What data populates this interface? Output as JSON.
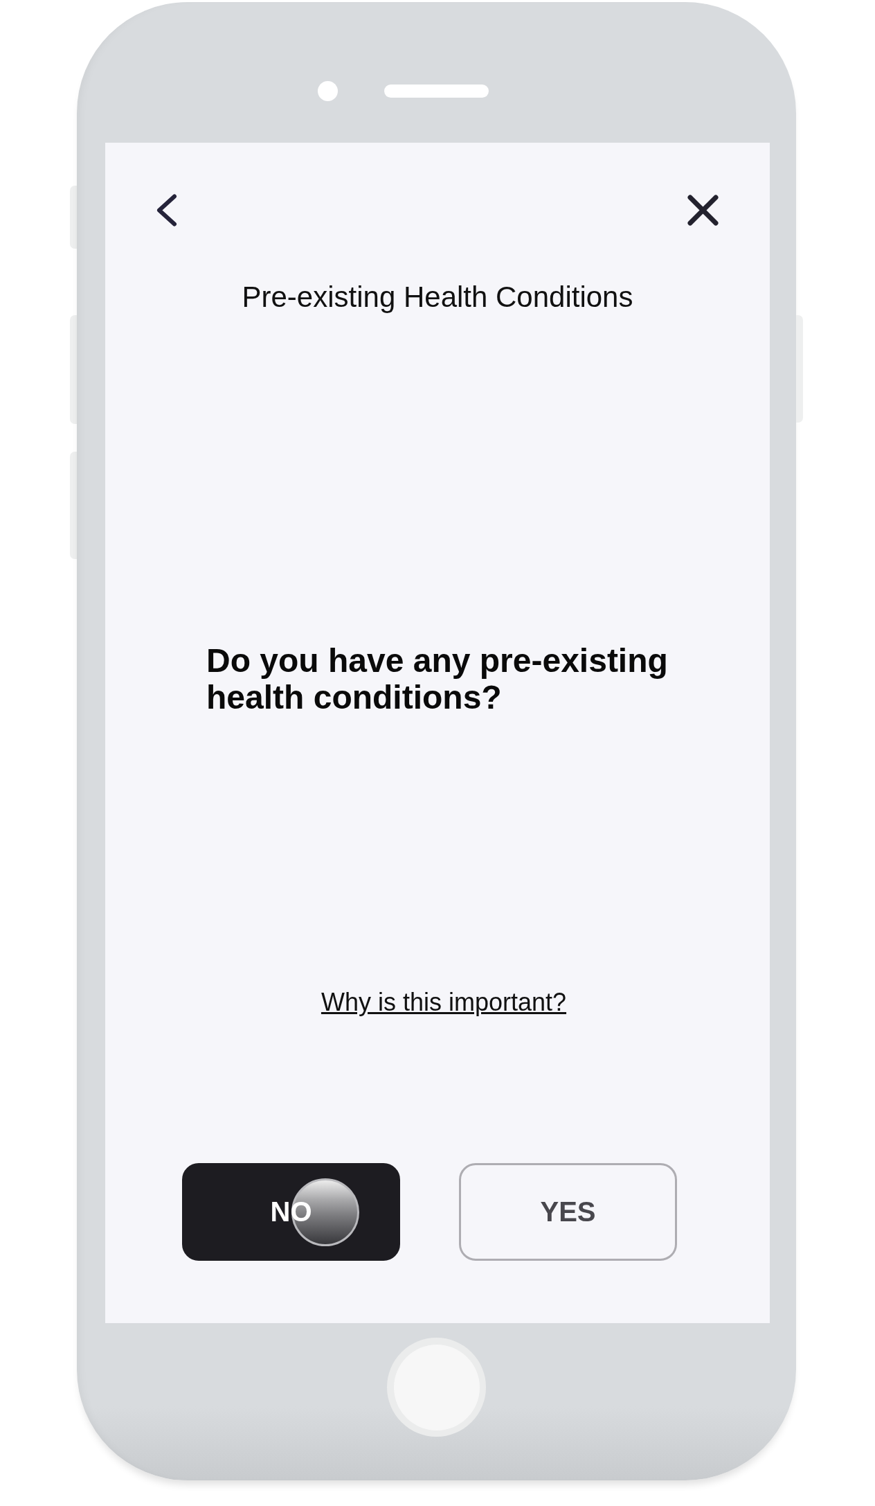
{
  "screen": {
    "title": "Pre-existing Health Conditions",
    "question": "Do you have any pre-existing health conditions?",
    "info_link": "Why is this important?",
    "options": [
      {
        "label": "NO",
        "selected": true
      },
      {
        "label": "YES",
        "selected": false
      }
    ]
  }
}
